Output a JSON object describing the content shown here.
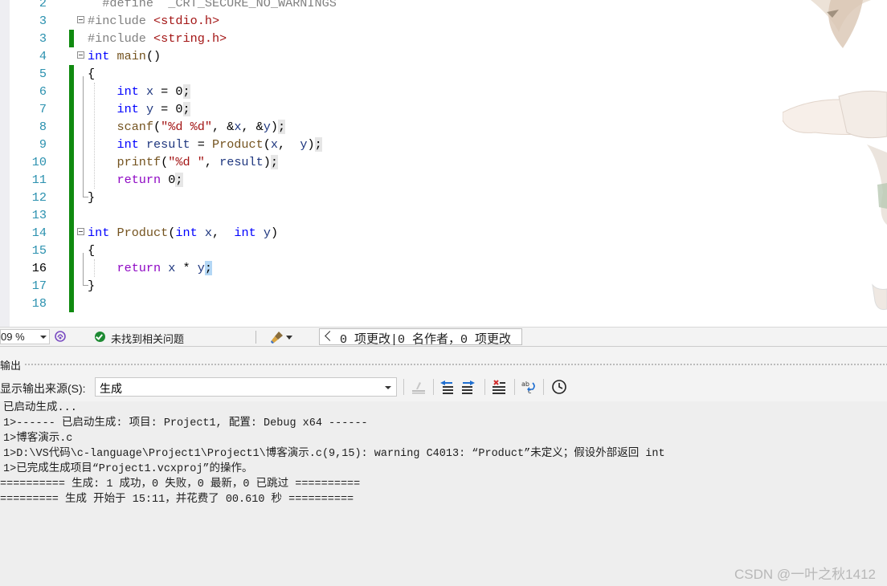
{
  "editor": {
    "lines": [
      {
        "num": "2",
        "tokens": [
          {
            "t": "  #define  _CRT_SECURE_NO_WARNINGS",
            "c": "pp"
          }
        ]
      },
      {
        "num": "3",
        "tokens": [
          {
            "t": "#include ",
            "c": "pp"
          },
          {
            "t": "<stdio.h>",
            "c": "inc"
          }
        ]
      },
      {
        "num": "3",
        "tokens": [
          {
            "t": "#include ",
            "c": "pp"
          },
          {
            "t": "<string.h>",
            "c": "inc"
          }
        ]
      },
      {
        "num": "4",
        "tokens": [
          {
            "t": "int",
            "c": "kw"
          },
          {
            "t": " "
          },
          {
            "t": "main",
            "c": "fn"
          },
          {
            "t": "()"
          }
        ]
      },
      {
        "num": "5",
        "tokens": [
          {
            "t": "{"
          }
        ]
      },
      {
        "num": "6",
        "tokens": [
          {
            "t": "    "
          },
          {
            "t": "int",
            "c": "kw"
          },
          {
            "t": " "
          },
          {
            "t": "x",
            "c": "var"
          },
          {
            "t": " = 0"
          },
          {
            "t": ";",
            "c": "semi"
          }
        ]
      },
      {
        "num": "7",
        "tokens": [
          {
            "t": "    "
          },
          {
            "t": "int",
            "c": "kw"
          },
          {
            "t": " "
          },
          {
            "t": "y",
            "c": "var"
          },
          {
            "t": " = 0"
          },
          {
            "t": ";",
            "c": "semi"
          }
        ]
      },
      {
        "num": "8",
        "tokens": [
          {
            "t": "    "
          },
          {
            "t": "scanf",
            "c": "fn"
          },
          {
            "t": "("
          },
          {
            "t": "\"%d %d\"",
            "c": "str"
          },
          {
            "t": ", &"
          },
          {
            "t": "x",
            "c": "var"
          },
          {
            "t": ", &"
          },
          {
            "t": "y",
            "c": "var"
          },
          {
            "t": ")"
          },
          {
            "t": ";",
            "c": "semi"
          }
        ]
      },
      {
        "num": "9",
        "tokens": [
          {
            "t": "    "
          },
          {
            "t": "int",
            "c": "kw"
          },
          {
            "t": " "
          },
          {
            "t": "result",
            "c": "var"
          },
          {
            "t": " = "
          },
          {
            "t": "Product",
            "c": "fn"
          },
          {
            "t": "("
          },
          {
            "t": "x",
            "c": "var"
          },
          {
            "t": ",  "
          },
          {
            "t": "y",
            "c": "var"
          },
          {
            "t": ")"
          },
          {
            "t": ";",
            "c": "semi"
          }
        ]
      },
      {
        "num": "10",
        "tokens": [
          {
            "t": "    "
          },
          {
            "t": "printf",
            "c": "fn"
          },
          {
            "t": "("
          },
          {
            "t": "\"%d \"",
            "c": "str"
          },
          {
            "t": ", "
          },
          {
            "t": "result",
            "c": "var"
          },
          {
            "t": ")"
          },
          {
            "t": ";",
            "c": "semi"
          }
        ]
      },
      {
        "num": "11",
        "tokens": [
          {
            "t": "    "
          },
          {
            "t": "return",
            "c": "ctrl"
          },
          {
            "t": " 0"
          },
          {
            "t": ";",
            "c": "semi"
          }
        ]
      },
      {
        "num": "12",
        "tokens": [
          {
            "t": "}"
          }
        ]
      },
      {
        "num": "13",
        "tokens": []
      },
      {
        "num": "14",
        "tokens": [
          {
            "t": "int",
            "c": "kw"
          },
          {
            "t": " "
          },
          {
            "t": "Product",
            "c": "fn"
          },
          {
            "t": "("
          },
          {
            "t": "int",
            "c": "kw"
          },
          {
            "t": " "
          },
          {
            "t": "x",
            "c": "var"
          },
          {
            "t": ",  "
          },
          {
            "t": "int",
            "c": "kw"
          },
          {
            "t": " "
          },
          {
            "t": "y",
            "c": "var"
          },
          {
            "t": ")"
          }
        ]
      },
      {
        "num": "15",
        "tokens": [
          {
            "t": "{"
          }
        ]
      },
      {
        "num": "16",
        "tokens": [
          {
            "t": "    "
          },
          {
            "t": "return",
            "c": "ctrl"
          },
          {
            "t": " "
          },
          {
            "t": "x",
            "c": "var"
          },
          {
            "t": " * "
          },
          {
            "t": "y",
            "c": "var"
          },
          {
            "t": ";",
            "c": "semi cur"
          }
        ]
      },
      {
        "num": "17",
        "tokens": [
          {
            "t": "}"
          }
        ]
      },
      {
        "num": "18",
        "tokens": []
      }
    ]
  },
  "status_strip": {
    "zoom": "09 %",
    "issues_text": "未找到相关问题",
    "changes_text": "0 项更改|0 名作者，0 项更改"
  },
  "output": {
    "title": "输出",
    "source_label": "显示输出来源(S):",
    "source_value": "生成",
    "lines": [
      "已启动生成...",
      "1>------ 已启动生成: 项目: Project1, 配置: Debug x64 ------",
      "1>博客演示.c",
      "1>D:\\VS代码\\c-language\\Project1\\Project1\\博客演示.c(9,15): warning C4013: “Product”未定义；假设外部返回 int",
      "1>已完成生成项目“Project1.vcxproj”的操作。",
      "========== 生成: 1 成功，0 失败，0 最新，0 已跳过 ==========",
      "========= 生成 开始于 15:11，并花费了 00.610 秒 =========="
    ]
  },
  "watermark": "CSDN @一叶之秋1412"
}
